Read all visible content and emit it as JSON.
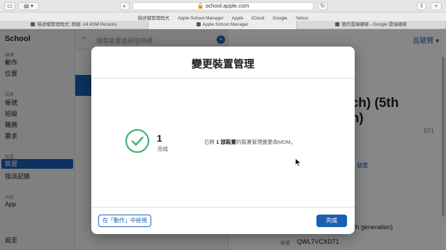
{
  "browser": {
    "url": "school.apple.com",
    "favorites": [
      "描述檔管理程式",
      "Apple School Manager",
      "Apple",
      "iCloud",
      "Google",
      "Yahoo"
    ],
    "tabs": [
      {
        "label": "描述檔管理程式: 群組: All ASM Persons",
        "active": false
      },
      {
        "label": "Apple School Manager",
        "active": true
      },
      {
        "label": "我的雲端硬碟 - Google 雲端硬碟",
        "active": false
      }
    ]
  },
  "sidebar": {
    "app_name": "School",
    "sections": [
      {
        "title": "機構",
        "items": [
          "動作",
          "位置"
        ]
      },
      {
        "title": "成員",
        "items": [
          "帳號",
          "班級",
          "職務",
          "要求"
        ]
      },
      {
        "title": "裝置",
        "items": [
          "裝置",
          "指派記錄"
        ]
      },
      {
        "title": "內容",
        "items": [
          "App"
        ]
      }
    ],
    "active_item": "裝置",
    "settings_label": "設定"
  },
  "main": {
    "search_placeholder": "搜尋裝置或掃描條碼",
    "user_name": "呂聰賢",
    "device_title_line1": "nch) (5th",
    "device_title_line2": "on)",
    "device_subtitle": "D71",
    "device_action": "裝置",
    "device_generation": "th generation)",
    "serial_label": "序號",
    "serial_value": "QWL7VCXD71"
  },
  "modal": {
    "title": "變更裝置管理",
    "count": "1",
    "count_label": "完成",
    "message_prefix": "已將 ",
    "message_bold": "1 部裝置",
    "message_suffix": "的裝置管理變更為MDM。",
    "view_button": "在「動作」中檢視",
    "done_button": "完成"
  },
  "colors": {
    "accent": "#1a5fb4",
    "success": "#3cb371"
  }
}
